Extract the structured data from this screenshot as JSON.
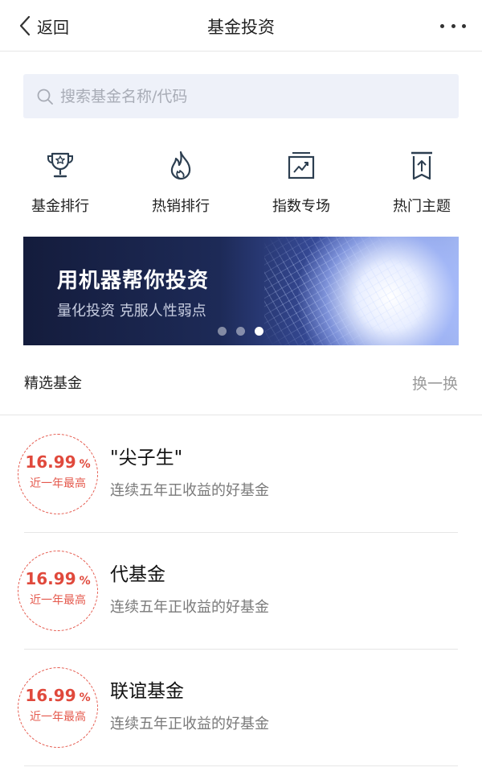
{
  "nav": {
    "back_label": "返回",
    "title": "基金投资"
  },
  "search": {
    "placeholder": "搜索基金名称/代码"
  },
  "quick_links": [
    {
      "label": "基金排行",
      "icon": "trophy-icon"
    },
    {
      "label": "热销排行",
      "icon": "flame-icon"
    },
    {
      "label": "指数专场",
      "icon": "trend-chart-icon"
    },
    {
      "label": "热门主题",
      "icon": "upload-bookmark-icon"
    }
  ],
  "banner": {
    "headline": "用机器帮你投资",
    "subline": "量化投资 克服人性弱点",
    "dots_total": 3,
    "active_dot": 3
  },
  "section": {
    "title": "精选基金",
    "refresh_label": "换一换"
  },
  "funds": [
    {
      "rate": "16.99",
      "pct": "%",
      "caption": "近一年最高",
      "name": "\"尖子生\"",
      "desc": "连续五年正收益的好基金"
    },
    {
      "rate": "16.99",
      "pct": "%",
      "caption": "近一年最高",
      "name": "代基金",
      "desc": "连续五年正收益的好基金"
    },
    {
      "rate": "16.99",
      "pct": "%",
      "caption": "近一年最高",
      "name": "联谊基金",
      "desc": "连续五年正收益的好基金"
    }
  ],
  "colors": {
    "accent_red": "#e0493c",
    "search_bg": "#eef1f9",
    "muted_text": "#9b9b9b"
  }
}
